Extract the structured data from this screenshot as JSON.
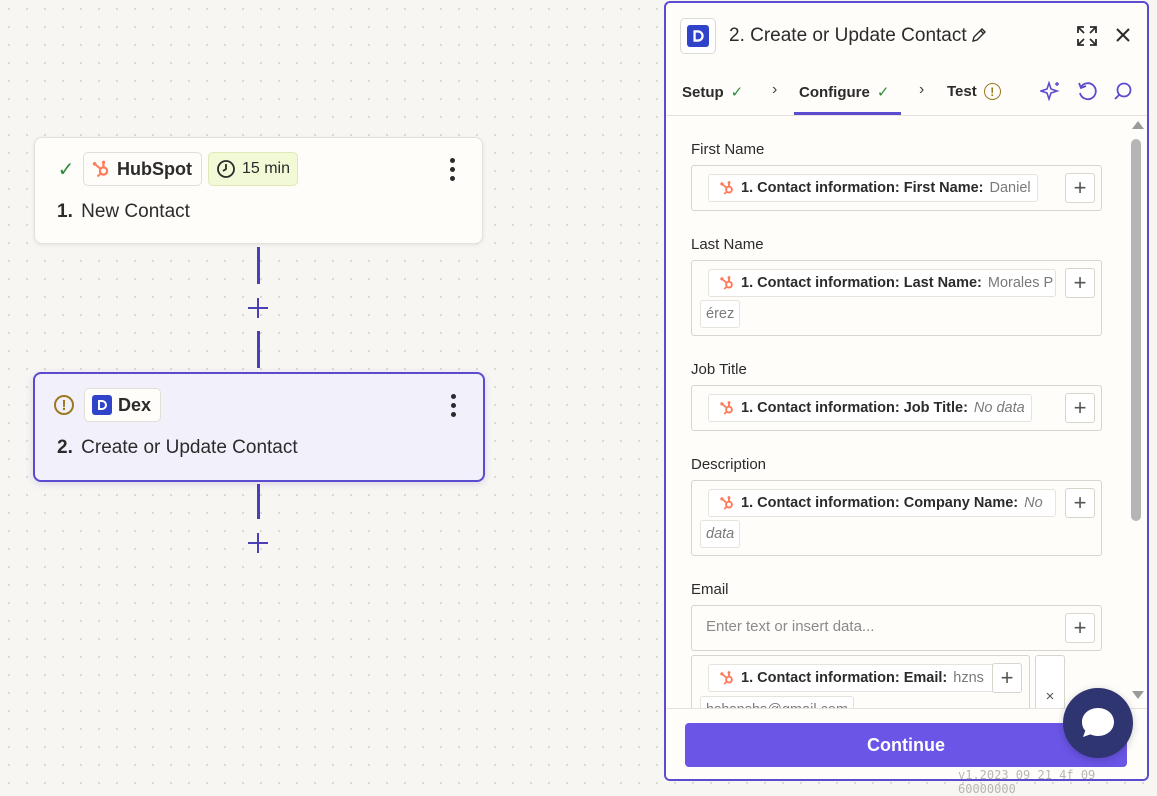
{
  "canvas": {
    "node1": {
      "app_name": "HubSpot",
      "schedule": "15 min",
      "step_number": "1.",
      "title": "New Contact"
    },
    "node2": {
      "app_name": "Dex",
      "step_number": "2.",
      "title": "Create or Update Contact"
    }
  },
  "panel": {
    "title": "2. Create or Update Contact",
    "tabs": [
      {
        "label": "Setup",
        "status": "complete"
      },
      {
        "label": "Configure",
        "status": "complete"
      },
      {
        "label": "Test",
        "status": "warning"
      }
    ],
    "fields": {
      "first_name": {
        "label": "First Name",
        "pill_key": "1. Contact information: First Name:",
        "pill_value": "Daniel"
      },
      "last_name": {
        "label": "Last Name",
        "pill_key": "1. Contact information: Last Name:",
        "pill_value": "Morales P",
        "pill_value_cont": "érez"
      },
      "job_title": {
        "label": "Job Title",
        "pill_key": "1. Contact information: Job Title:",
        "pill_value": "No data"
      },
      "description": {
        "label": "Description",
        "pill_key": "1. Contact information: Company Name:",
        "pill_value": "No",
        "pill_value_cont": "data"
      },
      "email": {
        "label": "Email",
        "placeholder": "Enter text or insert data...",
        "pill_key": "1. Contact information: Email:",
        "pill_value": "hzns",
        "pill_value_cont": "hshsnshs@gmail.com",
        "remove_symbol": "×"
      }
    },
    "continue_label": "Continue"
  },
  "colors": {
    "accent": "#5a4bcf",
    "button": "#6a55e6",
    "hubspot": "#ff7a59",
    "dex": "#2f44c9",
    "success": "#2e8b3a",
    "warning": "#9a7a1e"
  },
  "icons": {
    "hubspot": "hubspot-icon",
    "dex": "dex-icon",
    "check": "check-icon",
    "warning": "warning-icon",
    "clock": "clock-icon",
    "pencil": "pencil-icon",
    "expand": "expand-icon",
    "close": "close-icon",
    "ai": "sparkle-icon",
    "undo": "undo-icon",
    "search": "search-icon",
    "chat": "chat-icon"
  },
  "version_text": "v1.2023 09 21 4f 09 60000000"
}
